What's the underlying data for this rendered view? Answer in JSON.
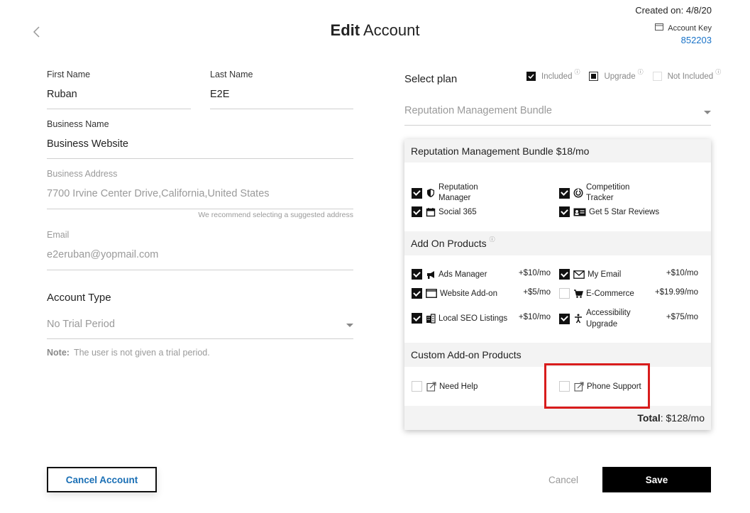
{
  "header": {
    "title_bold": "Edit",
    "title_rest": " Account",
    "created": "Created on: 4/8/20",
    "account_key_label": "Account Key",
    "account_key_value": "852203"
  },
  "form": {
    "first_name": {
      "label": "First Name",
      "value": "Ruban"
    },
    "last_name": {
      "label": "Last Name",
      "value": "E2E"
    },
    "business_name": {
      "label": "Business Name",
      "value": "Business Website"
    },
    "business_address": {
      "label": "Business Address",
      "value": "7700 Irvine Center Drive,California,United States",
      "hint": "We recommend selecting a suggested address"
    },
    "email": {
      "label": "Email",
      "value": "e2eruban@yopmail.com"
    },
    "account_type": {
      "heading": "Account Type",
      "value": "No Trial Period",
      "note_label": "Note:",
      "note_text": "The user is not given a trial period."
    }
  },
  "plan": {
    "label": "Select plan",
    "legend": {
      "included": "Included",
      "upgrade": "Upgrade",
      "not_included": "Not Included",
      "info": "ⓘ"
    },
    "selected": "Reputation Management Bundle",
    "bundle_heading": "Reputation Management Bundle $18/mo",
    "bundle_items": [
      {
        "label": "Reputation Manager",
        "checked": true,
        "icon": "shield-icon"
      },
      {
        "label": "Competition Tracker",
        "checked": true,
        "icon": "radar-icon"
      },
      {
        "label": "Social 365",
        "checked": true,
        "icon": "calendar-icon"
      },
      {
        "label": "Get 5 Star Reviews",
        "checked": true,
        "icon": "review-card-icon"
      }
    ],
    "addons_heading": "Add On Products",
    "addons_info": "ⓘ",
    "addons": [
      {
        "label": "Ads Manager",
        "price": "+$10/mo",
        "checked": true,
        "icon": "megaphone-icon"
      },
      {
        "label": "My Email",
        "price": "+$10/mo",
        "checked": true,
        "icon": "envelope-icon"
      },
      {
        "label": "Website Add-on",
        "price": "+$5/mo",
        "checked": true,
        "icon": "monitor-icon"
      },
      {
        "label": "E-Commerce",
        "price": "+$19.99/mo",
        "checked": false,
        "icon": "cart-icon"
      },
      {
        "label": "Local SEO Listings",
        "price": "+$10/mo",
        "checked": true,
        "icon": "building-icon"
      },
      {
        "label": "Accessibility Upgrade",
        "price": "+$75/mo",
        "checked": true,
        "icon": "accessibility-icon"
      }
    ],
    "custom_heading": "Custom Add-on Products",
    "custom": [
      {
        "label": "Need Help",
        "checked": false,
        "icon": "external-link-icon"
      },
      {
        "label": "Phone Support",
        "checked": false,
        "icon": "external-link-icon"
      }
    ],
    "total_label": "Total",
    "total_value": ": $128/mo"
  },
  "footer": {
    "cancel_account": "Cancel Account",
    "cancel": "Cancel",
    "save": "Save"
  },
  "colors": {
    "link_blue": "#1a73c8",
    "highlight_red": "#d81c1c",
    "primary_black": "#000000"
  }
}
